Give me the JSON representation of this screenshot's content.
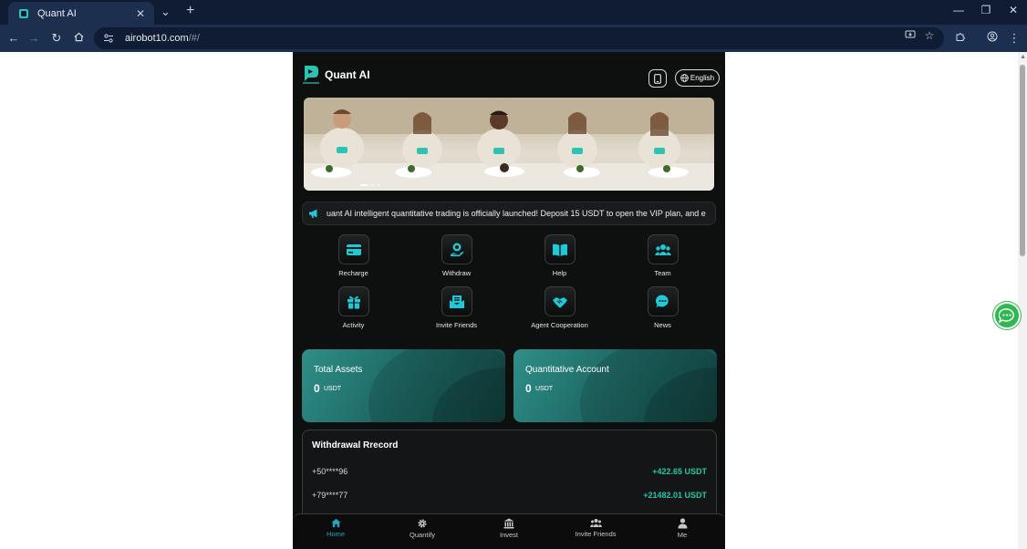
{
  "browser": {
    "tab_title": "Quant AI",
    "url_host": "airobot10.com",
    "url_path": "/#/",
    "icons": {
      "back": "back-arrow-icon",
      "forward": "forward-arrow-icon",
      "reload": "reload-icon",
      "home": "home-icon",
      "close_tab": "close-icon",
      "new_tab": "plus-icon",
      "tab_search": "chevron-down-icon",
      "install": "install-app-icon",
      "bookmark": "star-icon",
      "extensions": "puzzle-icon",
      "profile": "profile-icon",
      "menu": "kebab-menu-icon"
    }
  },
  "app": {
    "title": "Quant AI",
    "language": "English",
    "notice": "uant AI intelligent quantitative trading is officially launched! Deposit 15 USDT to open the VIP plan, and e",
    "shortcuts": [
      {
        "label": "Recharge",
        "icon": "wallet-icon"
      },
      {
        "label": "Withdraw",
        "icon": "user-hand-icon"
      },
      {
        "label": "Help",
        "icon": "book-icon"
      },
      {
        "label": "Team",
        "icon": "team-icon"
      },
      {
        "label": "Activity",
        "icon": "gift-icon"
      },
      {
        "label": "Invite Friends",
        "icon": "envelope-icon"
      },
      {
        "label": "Agent Cooperation",
        "icon": "handshake-icon"
      },
      {
        "label": "News",
        "icon": "chat-bubble-icon"
      }
    ],
    "cards": [
      {
        "label": "Total Assets",
        "value": "0",
        "unit": "USDT"
      },
      {
        "label": "Quantitative Account",
        "value": "0",
        "unit": "USDT"
      }
    ],
    "records": {
      "title": "Withdrawal Rrecord",
      "rows": [
        {
          "phone": "+50****96",
          "amount": "+422.65 USDT"
        },
        {
          "phone": "+79****77",
          "amount": "+21482.01 USDT"
        }
      ]
    },
    "nav": [
      {
        "label": "Home",
        "icon": "home-icon",
        "active": true
      },
      {
        "label": "Quantify",
        "icon": "gear-icon"
      },
      {
        "label": "Invest",
        "icon": "bank-icon"
      },
      {
        "label": "Invite Friends",
        "icon": "people-icon"
      },
      {
        "label": "Me",
        "icon": "person-icon"
      }
    ],
    "colors": {
      "accent": "#1aa9c8",
      "teal": "#20c9a3",
      "card": "#2f8f88",
      "background": "#0e0f0f",
      "chat": "#2fb84f"
    }
  }
}
